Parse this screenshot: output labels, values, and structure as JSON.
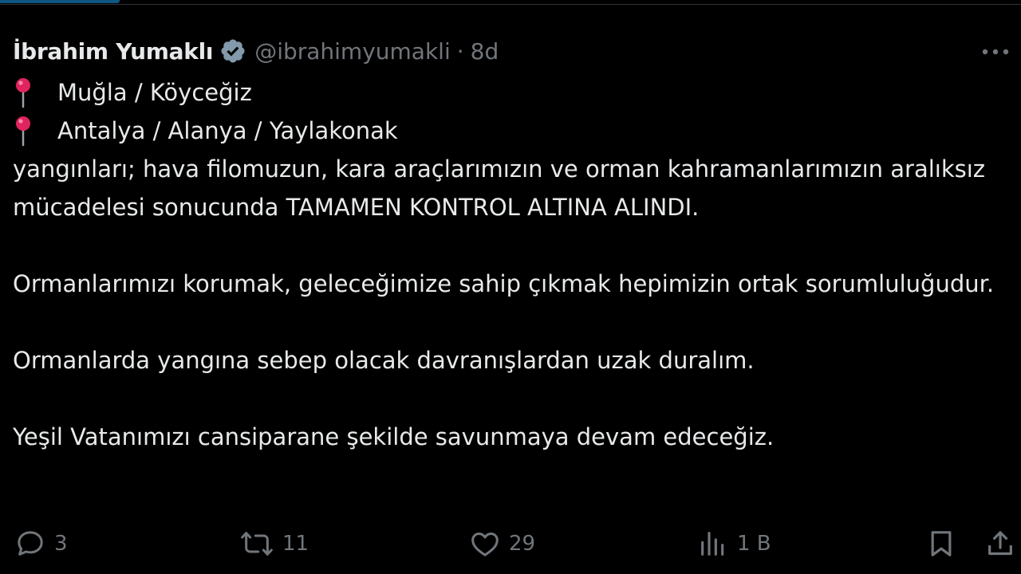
{
  "author": {
    "name": "İbrahim Yumaklı",
    "handle": "@ibrahimyumakli",
    "separator": "·",
    "time": "8d"
  },
  "body": {
    "locations": [
      "Muğla / Köyceğiz",
      "Antalya / Alanya / Yaylakonak"
    ],
    "paragraphs": [
      "yangınları; hava filomuzun, kara araçlarımızın ve orman kahramanlarımızın aralıksız mücadelesi sonucunda TAMAMEN KONTROL ALTINA ALINDI.",
      "Ormanlarımızı korumak, geleceğimize sahip çıkmak hepimizin ortak sorumluluğudur.",
      "Ormanlarda yangına sebep olacak davranışlardan uzak duralım.",
      "Yeşil Vatanımızı cansiparane şekilde savunmaya devam edeceğiz."
    ]
  },
  "actions": {
    "replies": "3",
    "reposts": "11",
    "likes": "29",
    "views": "1 B"
  },
  "colors": {
    "background": "#000000",
    "text": "#e7e9ea",
    "secondary": "#71767b",
    "verified": "#829aab",
    "pin": "#e0245e"
  }
}
